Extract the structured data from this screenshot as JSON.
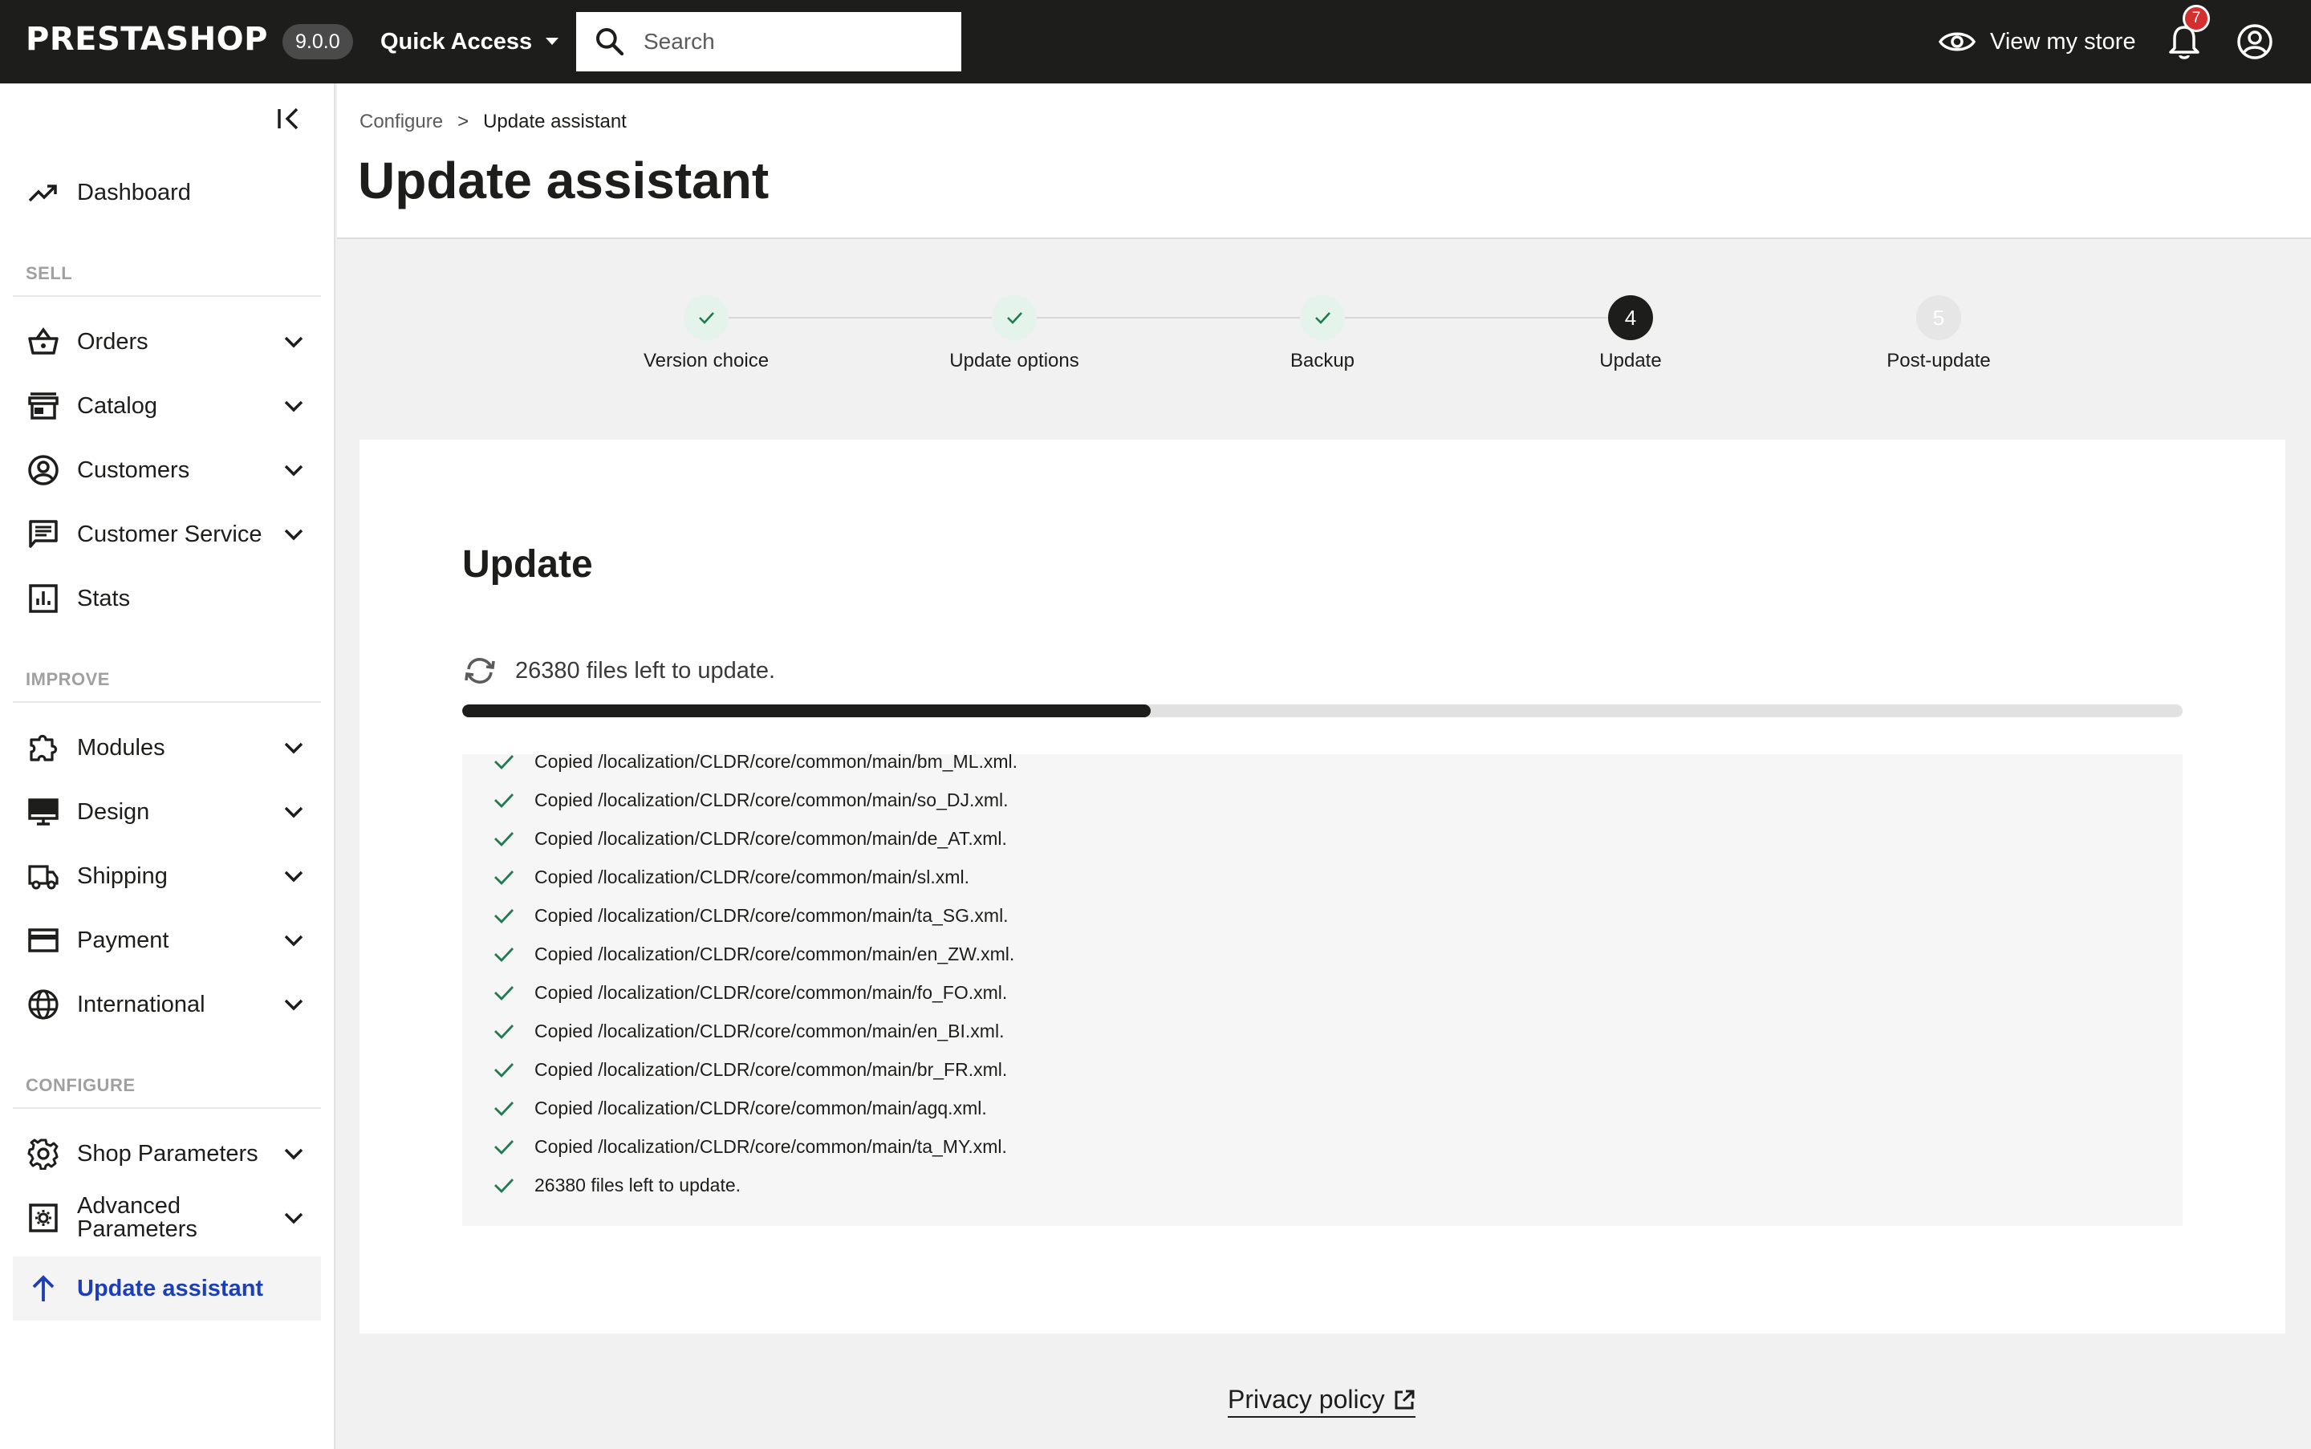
{
  "header": {
    "logo": "PRESTASHOP",
    "version": "9.0.0",
    "quick_access": "Quick Access",
    "search_placeholder": "Search",
    "view_store": "View my store",
    "notification_count": "7",
    "bg_color": "#1d1d1b"
  },
  "sidebar": {
    "dashboard": "Dashboard",
    "sections": {
      "sell": "SELL",
      "improve": "IMPROVE",
      "configure": "CONFIGURE"
    },
    "items": {
      "orders": "Orders",
      "catalog": "Catalog",
      "customers": "Customers",
      "customer_service": "Customer Service",
      "stats": "Stats",
      "modules": "Modules",
      "design": "Design",
      "shipping": "Shipping",
      "payment": "Payment",
      "international": "International",
      "shop_parameters": "Shop Parameters",
      "advanced_line1": "Advanced",
      "advanced_line2": "Parameters",
      "update_assistant": "Update assistant"
    },
    "active_color": "#1d3fb5"
  },
  "breadcrumb": {
    "parent": "Configure",
    "separator": ">",
    "current": "Update assistant"
  },
  "page_title": "Update assistant",
  "stepper": {
    "steps": [
      {
        "label": "Version choice",
        "state": "done"
      },
      {
        "label": "Update options",
        "state": "done"
      },
      {
        "label": "Backup",
        "state": "done"
      },
      {
        "label": "Update",
        "state": "current",
        "number": "4"
      },
      {
        "label": "Post-update",
        "state": "todo",
        "number": "5"
      }
    ]
  },
  "update": {
    "title": "Update",
    "status": "26380 files left to update.",
    "progress_fraction": 0.4,
    "log": [
      "Copied /localization/CLDR/core/common/main/bm_ML.xml.",
      "Copied /localization/CLDR/core/common/main/so_DJ.xml.",
      "Copied /localization/CLDR/core/common/main/de_AT.xml.",
      "Copied /localization/CLDR/core/common/main/sl.xml.",
      "Copied /localization/CLDR/core/common/main/ta_SG.xml.",
      "Copied /localization/CLDR/core/common/main/en_ZW.xml.",
      "Copied /localization/CLDR/core/common/main/fo_FO.xml.",
      "Copied /localization/CLDR/core/common/main/en_BI.xml.",
      "Copied /localization/CLDR/core/common/main/br_FR.xml.",
      "Copied /localization/CLDR/core/common/main/agq.xml.",
      "Copied /localization/CLDR/core/common/main/ta_MY.xml.",
      "26380 files left to update."
    ],
    "check_color": "#1f7a4c"
  },
  "footer": {
    "privacy": "Privacy policy"
  }
}
